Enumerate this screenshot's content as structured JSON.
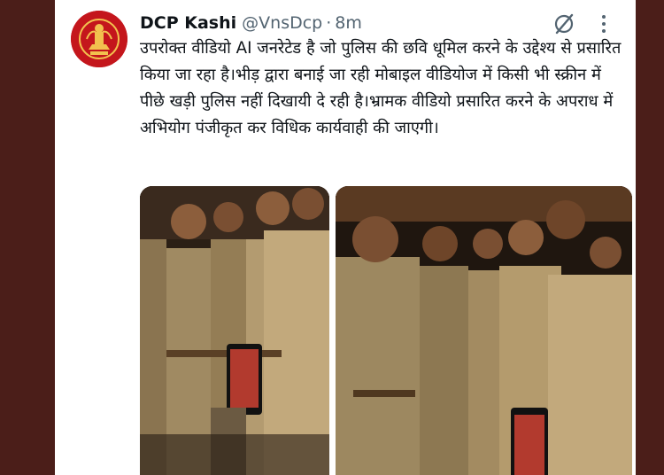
{
  "tweet": {
    "display_name": "DCP Kashi",
    "handle": "@VnsDcp",
    "separator": "·",
    "time": "8m",
    "text": "उपरोक्त वीडियो AI जनरेटेड है जो पुलिस की छवि धूमिल करने के उद्देश्य से प्रसारित किया जा रहा है।भीड़ द्वारा बनाई जा रही मोबाइल वीडियोज में किसी भी स्क्रीन में पीछे खड़ी पुलिस नहीं दिखायी दे रही है।भ्रामक वीडियो प्रसारित करने के अपराध में अभियोग पंजीकृत कर विधिक कार्यवाही की जाएगी।"
  },
  "icons": {
    "avatar": "up-police-emblem",
    "grok": "grok-icon",
    "more": "more-options-icon"
  },
  "colors": {
    "avatar_bg": "#c4161c",
    "name": "#0f1419",
    "secondary": "#536471",
    "frame": "#4b1e19"
  }
}
